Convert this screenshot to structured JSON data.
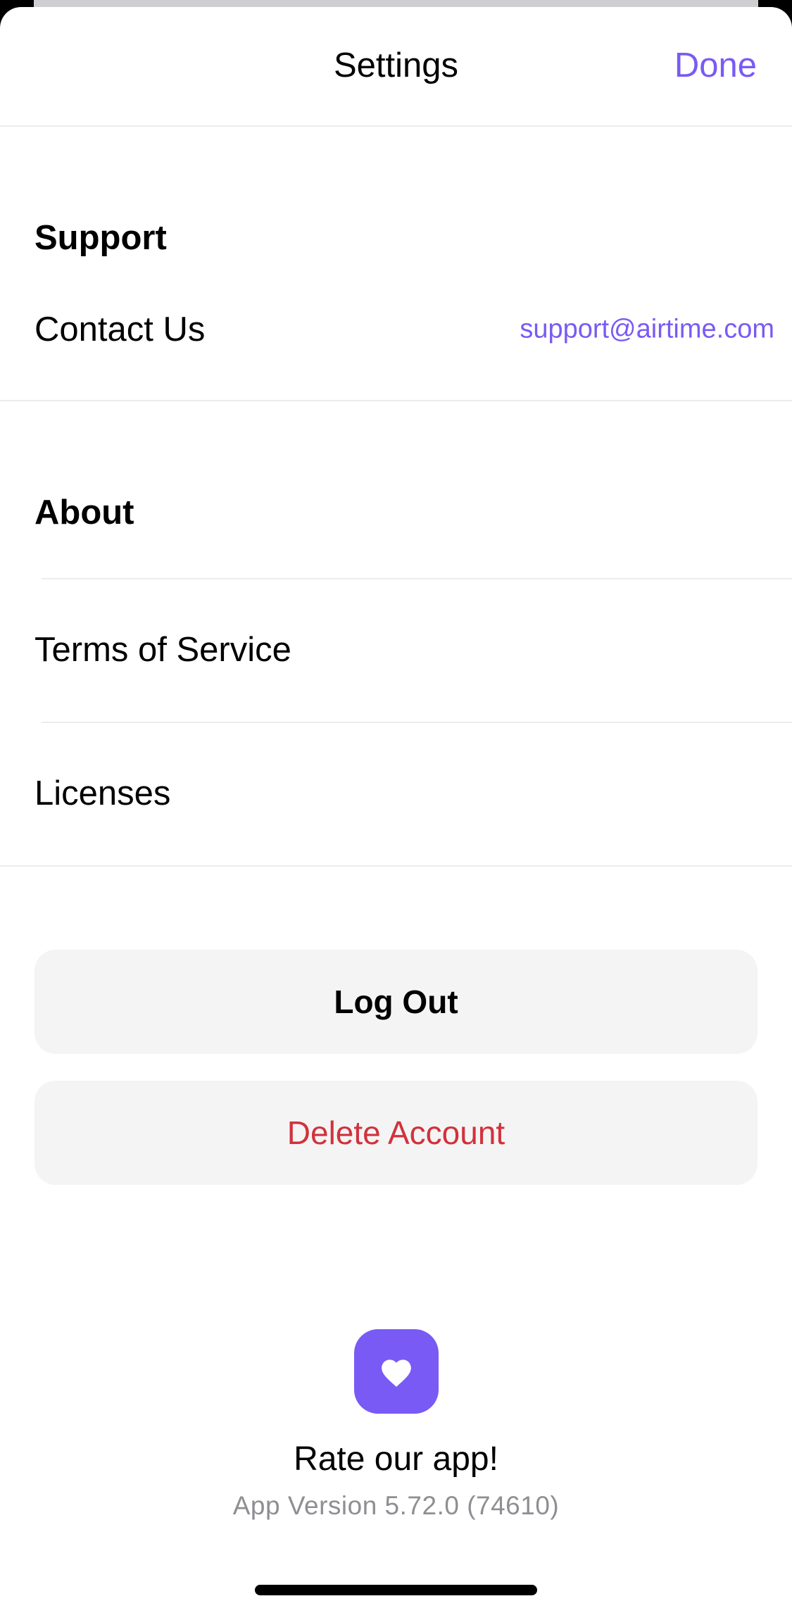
{
  "nav": {
    "title": "Settings",
    "done_label": "Done"
  },
  "support": {
    "header": "Support",
    "contact_label": "Contact Us",
    "contact_value": "support@airtime.com"
  },
  "about": {
    "header": "About",
    "items": [
      {
        "label": "Terms of Service"
      },
      {
        "label": "Licenses"
      }
    ]
  },
  "actions": {
    "logout_label": "Log Out",
    "delete_label": "Delete Account"
  },
  "footer": {
    "rate_icon": "heart-icon",
    "rate_label": "Rate our app!",
    "version": "App Version 5.72.0 (74610)"
  },
  "colors": {
    "accent": "#7a5af5",
    "destructive": "#d1323c",
    "button_bg": "#f4f4f4",
    "secondary_text": "#8e8e93"
  }
}
